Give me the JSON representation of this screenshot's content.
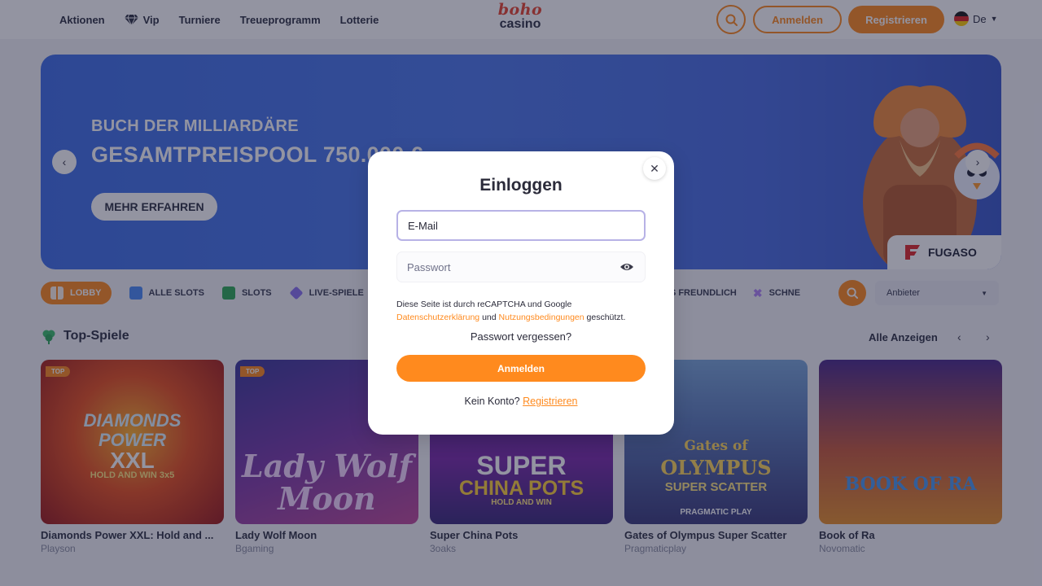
{
  "header": {
    "nav": [
      {
        "label": "Aktionen"
      },
      {
        "label": "Vip"
      },
      {
        "label": "Turniere"
      },
      {
        "label": "Treueprogramm"
      },
      {
        "label": "Lotterie"
      }
    ],
    "logo_top": "boho",
    "logo_bottom": "casino",
    "login_label": "Anmelden",
    "register_label": "Registrieren",
    "language": "De"
  },
  "banner": {
    "subtitle": "BUCH DER MILLIARDÄRE",
    "title": "GESAMTPREISPOOL 750.000 €",
    "cta": "MEHR ERFAHREN",
    "provider": "FUGASO"
  },
  "categories": [
    {
      "label": "LOBBY"
    },
    {
      "label": "ALLE SLOTS"
    },
    {
      "label": "SLOTS"
    },
    {
      "label": "LIVE-SPIELE"
    }
  ],
  "categories_right": [
    {
      "label": "US FREUNDLICH"
    },
    {
      "label": "SCHNE"
    }
  ],
  "provider_select": "Anbieter",
  "section": {
    "title": "Top-Spiele",
    "show_all": "Alle Anzeigen"
  },
  "games": [
    {
      "name": "Diamonds Power XXL: Hold and ...",
      "provider": "Playson",
      "badge": "TOP",
      "art_line1": "DIAMONDS",
      "art_line2": "POWER",
      "art_line3": "XXL",
      "art_line4": "HOLD AND WIN 3x5"
    },
    {
      "name": "Lady Wolf Moon",
      "provider": "Bgaming",
      "badge": "TOP",
      "art_line1": "Lady Wolf",
      "art_line2": "Moon"
    },
    {
      "name": "Super China Pots",
      "provider": "3oaks",
      "art_line1": "SUPER",
      "art_line2": "CHINA POTS",
      "art_line3": "HOLD AND WIN"
    },
    {
      "name": "Gates of Olympus Super Scatter",
      "provider": "Pragmaticplay",
      "art_line1": "Gates of",
      "art_line2": "OLYMPUS",
      "art_line3": "SUPER SCATTER",
      "art_line4": "PRAGMATIC PLAY"
    },
    {
      "name": "Book of Ra",
      "provider": "Novomatic",
      "art_line1": "BOOK OF RA"
    }
  ],
  "modal": {
    "title": "Einloggen",
    "email_placeholder": "E-Mail",
    "password_placeholder": "Passwort",
    "recaptcha_text": "Diese Seite ist durch reCAPTCHA und Google",
    "privacy_link": "Datenschutzerklärung",
    "and_word": "und",
    "terms_link": "Nutzungsbedingungen",
    "protected_word": "geschützt.",
    "forgot_password": "Passwort vergessen?",
    "submit_label": "Anmelden",
    "no_account_text": "Kein Konto?",
    "register_link": "Registrieren"
  },
  "colors": {
    "accent": "#ff8a1e",
    "banner": "#4c78ea",
    "overlay": "rgba(26,28,56,0.47)"
  }
}
